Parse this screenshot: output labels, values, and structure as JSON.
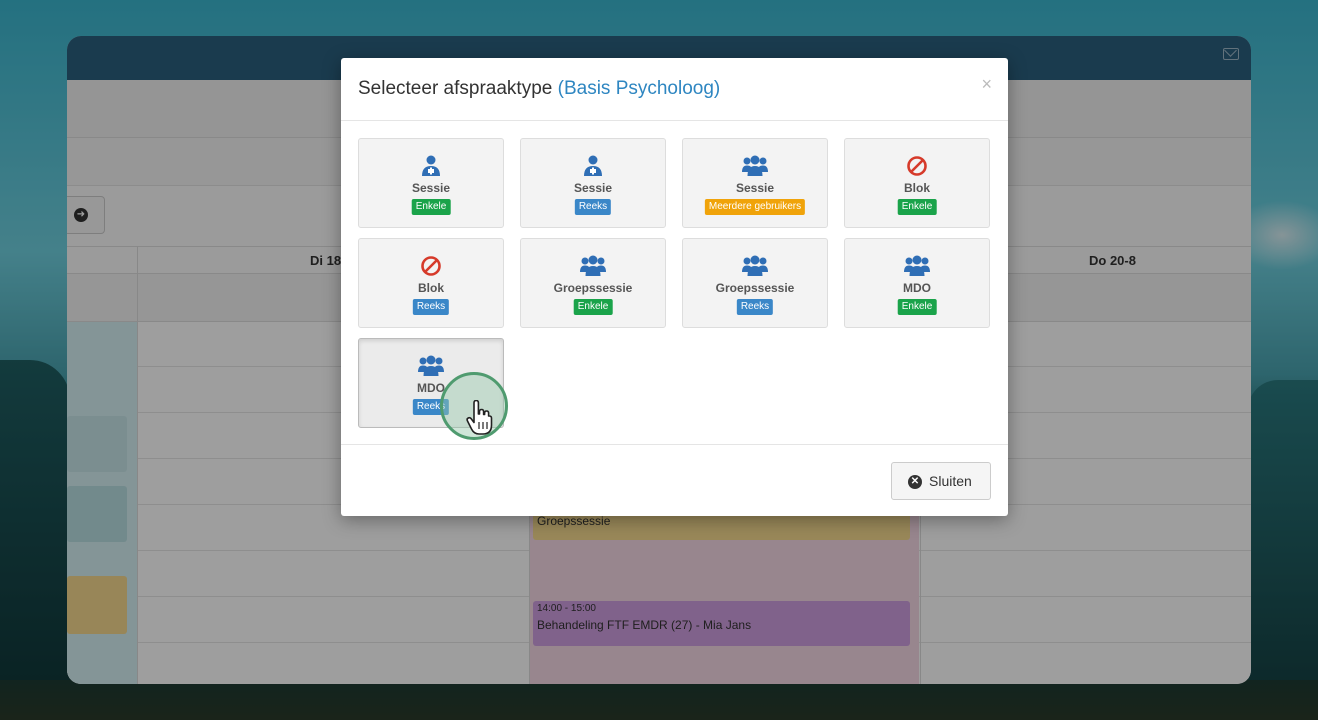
{
  "background": {
    "app_header_color": "#2a5f7f",
    "icons": [
      "mail-icon",
      "arrow-right-icon"
    ]
  },
  "calendar": {
    "day_headers": [
      "Di 18",
      "Do 20-8"
    ],
    "events": [
      {
        "time": "",
        "title": "Groepssessie"
      },
      {
        "time": "14:00 - 15:00",
        "title": "Behandeling FTF EMDR (27) - Mia Jans"
      }
    ]
  },
  "modal": {
    "title_prefix": "Selecteer afspraaktype",
    "title_accent": "(Basis Psycholoog)",
    "close_symbol": "×",
    "accent_color": "#2e86c1",
    "tiles": [
      {
        "icon": "user-md-icon",
        "label": "Sessie",
        "badge": "Enkele",
        "badge_color": "green"
      },
      {
        "icon": "user-md-icon",
        "label": "Sessie",
        "badge": "Reeks",
        "badge_color": "blue"
      },
      {
        "icon": "users-icon",
        "label": "Sessie",
        "badge": "Meerdere gebruikers",
        "badge_color": "orange"
      },
      {
        "icon": "ban-icon",
        "label": "Blok",
        "badge": "Enkele",
        "badge_color": "green"
      },
      {
        "icon": "ban-icon",
        "label": "Blok",
        "badge": "Reeks",
        "badge_color": "blue"
      },
      {
        "icon": "users-icon",
        "label": "Groepssessie",
        "badge": "Enkele",
        "badge_color": "green"
      },
      {
        "icon": "users-icon",
        "label": "Groepssessie",
        "badge": "Reeks",
        "badge_color": "blue"
      },
      {
        "icon": "users-icon",
        "label": "MDO",
        "badge": "Enkele",
        "badge_color": "green"
      },
      {
        "icon": "users-icon",
        "label": "MDO",
        "badge": "Reeks",
        "badge_color": "blue"
      }
    ],
    "footer": {
      "close_label": "Sluiten",
      "close_icon": "times-circle-icon"
    }
  },
  "cursor": {
    "icon": "hand-pointer-icon"
  }
}
